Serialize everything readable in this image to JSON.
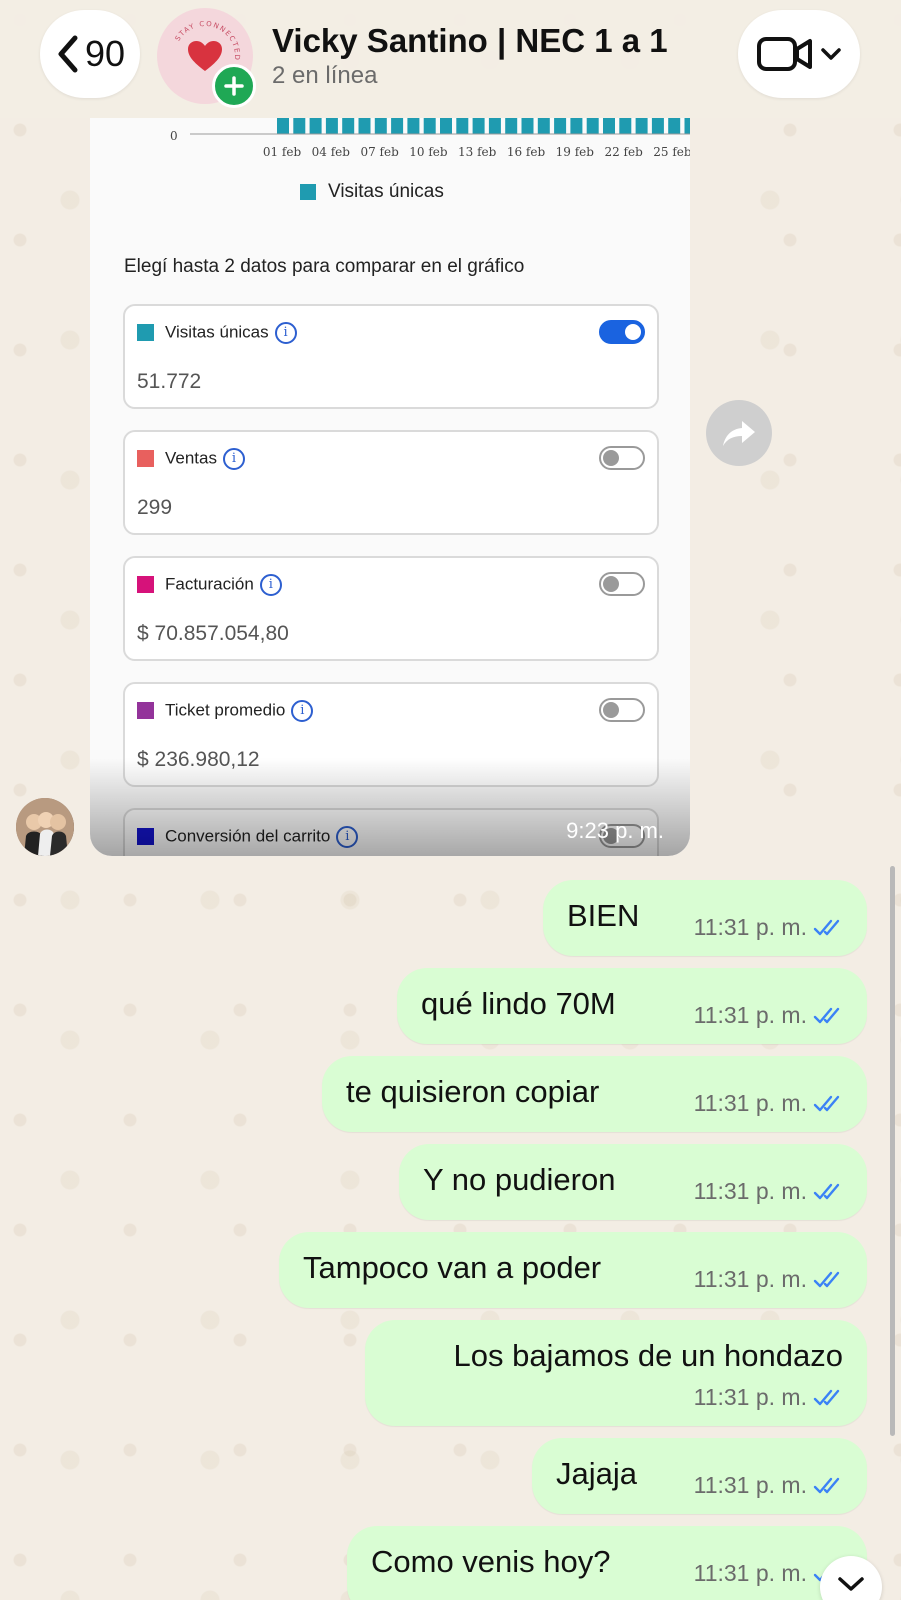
{
  "header": {
    "back_count": "90",
    "chat_title": "Vicky Santino | NEC 1 a 1",
    "chat_subtitle": "2 en línea",
    "avatar_ring_text": "STAY CONNECTED"
  },
  "image_message": {
    "timestamp": "9:23 p. m.",
    "chart_data": {
      "type": "bar",
      "categories": [
        "01 feb",
        "04 feb",
        "07 feb",
        "10 feb",
        "13 feb",
        "16 feb",
        "19 feb",
        "22 feb",
        "25 feb"
      ],
      "y_tick": "0",
      "series": [
        {
          "name": "Visitas únicas",
          "color": "#1f9bb0"
        }
      ]
    },
    "legend_label": "Visitas únicas",
    "compare_title": "Elegí hasta 2 datos para comparar en el gráfico",
    "metrics": [
      {
        "label": "Visitas únicas",
        "value": "51.772",
        "color": "#1f9bb0",
        "enabled": true
      },
      {
        "label": "Ventas",
        "value": "299",
        "color": "#e8605e",
        "enabled": false
      },
      {
        "label": "Facturación",
        "value": "$ 70.857.054,80",
        "color": "#d6127a",
        "enabled": false
      },
      {
        "label": "Ticket promedio",
        "value": "$ 236.980,12",
        "color": "#93339a",
        "enabled": false
      },
      {
        "label": "Conversión del carrito",
        "value": "",
        "color": "#1414cc",
        "enabled": false
      }
    ],
    "info_glyph": "i"
  },
  "messages": [
    {
      "text": "BIEN",
      "time": "11:31 p. m.",
      "status": "read"
    },
    {
      "text": "qué lindo 70M",
      "time": "11:31 p. m.",
      "status": "read"
    },
    {
      "text": "te quisieron copiar",
      "time": "11:31 p. m.",
      "status": "read"
    },
    {
      "text": "Y no pudieron",
      "time": "11:31 p. m.",
      "status": "read"
    },
    {
      "text": "Tampoco van a poder",
      "time": "11:31 p. m.",
      "status": "read"
    },
    {
      "text": "Los bajamos de un hondazo",
      "time": "11:31 p. m.",
      "status": "read"
    },
    {
      "text": "Jajaja",
      "time": "11:31 p. m.",
      "status": "read"
    },
    {
      "text": "Como venis hoy?",
      "time": "11:31 p. m.",
      "status": "read"
    }
  ],
  "colors": {
    "outgoing_bubble": "#d9fdd3",
    "read_ticks": "#3b82f6",
    "add_badge": "#1fa855",
    "toggle_on": "#1a63e0"
  }
}
